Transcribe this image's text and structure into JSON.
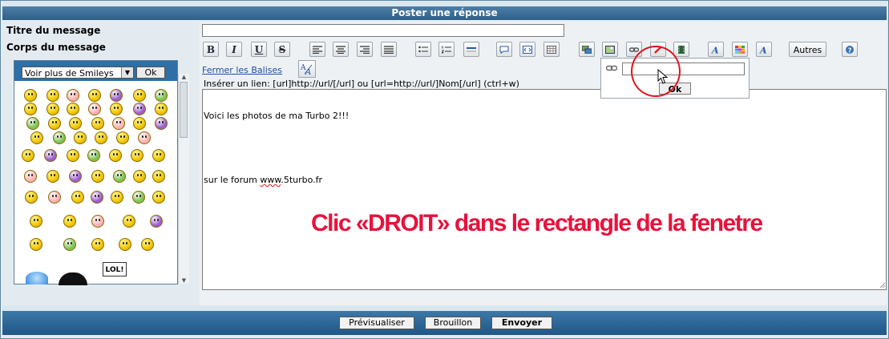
{
  "header": {
    "title": "Poster une réponse"
  },
  "labels": {
    "subject": "Titre du message",
    "body": "Corps du message"
  },
  "subject": {
    "value": ""
  },
  "toolbar": {
    "buttons": [
      {
        "name": "bold-button",
        "text": "B",
        "icon": "bold-icon"
      },
      {
        "name": "italic-button",
        "text": "I",
        "icon": "italic-icon"
      },
      {
        "name": "underline-button",
        "text": "U",
        "icon": "underline-icon"
      },
      {
        "name": "strike-button",
        "text": "S",
        "icon": "strikethrough-icon"
      },
      {
        "name": "align-left-button",
        "icon": "align-left-icon"
      },
      {
        "name": "align-center-button",
        "icon": "align-center-icon"
      },
      {
        "name": "align-right-button",
        "icon": "align-right-icon"
      },
      {
        "name": "justify-button",
        "icon": "justify-icon"
      },
      {
        "name": "list-bullet-button",
        "icon": "bullet-list-icon"
      },
      {
        "name": "list-number-button",
        "icon": "numbered-list-icon"
      },
      {
        "name": "hr-button",
        "icon": "horizontal-rule-icon"
      },
      {
        "name": "quote-button",
        "icon": "quote-icon"
      },
      {
        "name": "code-button",
        "icon": "code-icon"
      },
      {
        "name": "table-button",
        "icon": "table-icon"
      },
      {
        "name": "image-gallery-button",
        "icon": "gallery-icon"
      },
      {
        "name": "image-button",
        "icon": "image-icon"
      },
      {
        "name": "link-button",
        "icon": "link-icon"
      },
      {
        "name": "flash-button",
        "icon": "flash-icon"
      },
      {
        "name": "video-button",
        "icon": "film-icon"
      },
      {
        "name": "font-button",
        "icon": "font-icon"
      },
      {
        "name": "color-button",
        "icon": "color-palette-icon"
      },
      {
        "name": "font-style-button",
        "icon": "font-style-icon"
      }
    ],
    "others_label": "Autres",
    "help_icon": "help-icon"
  },
  "close_tags_label": "Fermer les Balises",
  "hint": "Insérer un lien: [url]http://url/[/url] ou [url=http://url/]Nom[/url] (ctrl+w)",
  "message": {
    "line1": "Voici les photos de ma Turbo 2!!!",
    "line2_prefix": "sur le forum ",
    "line2_link": "www",
    "line2_suffix": ".5turbo.fr"
  },
  "annotation": "Clic «DROIT» dans le rectangle de la fenetre",
  "link_popup": {
    "ok_label": "Ok",
    "input_value": ""
  },
  "smileys": {
    "select_label": "Voir plus de Smileys",
    "ok_label": "Ok",
    "badge_text": "LOL!"
  },
  "footer": {
    "preview": "Prévisualiser",
    "draft": "Brouillon",
    "send": "Envoyer"
  },
  "colors": {
    "header": "#2d5f87",
    "annotation": "#e8123c",
    "circle": "#e0151f",
    "smiley_panel": "#2e6fa6"
  }
}
